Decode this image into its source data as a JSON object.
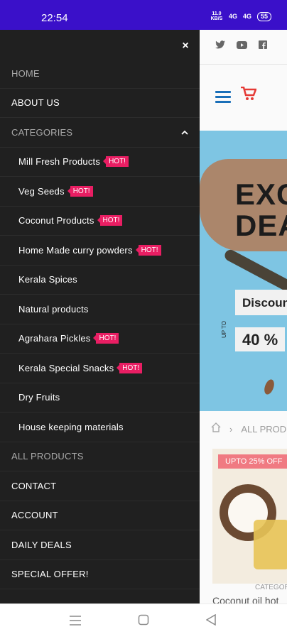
{
  "status_bar": {
    "time": "22:54",
    "net_speed": "11.0 KB/S",
    "sig1": "4G",
    "sig2": "4G",
    "battery": "55"
  },
  "background_page": {
    "hero_title": "EXC DEA",
    "discount_text": "Discoun",
    "upto_text": "UP TO",
    "percent": "40 %",
    "breadcrumb_text": "ALL PROD",
    "badge": "UPTO 25% OFF",
    "category_label": "CATEGOR",
    "product_name": "Coconut oil hot"
  },
  "drawer": {
    "close_label": "×",
    "items": [
      {
        "label": "HOME"
      },
      {
        "label": "ABOUT US"
      },
      {
        "label": "CATEGORIES"
      },
      {
        "label": "Mill Fresh Products",
        "hot": "HOT!"
      },
      {
        "label": "Veg Seeds",
        "hot": "HOT!"
      },
      {
        "label": "Coconut Products",
        "hot": "HOT!"
      },
      {
        "label": "Home Made curry powders",
        "hot": "HOT!"
      },
      {
        "label": "Kerala Spices"
      },
      {
        "label": "Natural products"
      },
      {
        "label": "Agrahara Pickles",
        "hot": "HOT!"
      },
      {
        "label": "Kerala Special Snacks",
        "hot": "HOT!"
      },
      {
        "label": "Dry Fruits"
      },
      {
        "label": "House keeping materials"
      },
      {
        "label": "ALL PRODUCTS"
      },
      {
        "label": "CONTACT"
      },
      {
        "label": "ACCOUNT"
      },
      {
        "label": "DAILY DEALS"
      },
      {
        "label": "SPECIAL OFFER!"
      }
    ]
  },
  "colors": {
    "status_bar": "#3a10c9",
    "drawer_bg": "#202020",
    "hot_badge": "#e91e63",
    "hero_bg": "#7ec5e3"
  },
  "icons": {
    "twitter": "twitter-icon",
    "youtube": "youtube-icon",
    "facebook": "facebook-icon",
    "menu": "hamburger-icon",
    "cart": "cart-icon",
    "home": "home-icon",
    "chevron": "chevron-up-icon",
    "close": "close-icon"
  }
}
